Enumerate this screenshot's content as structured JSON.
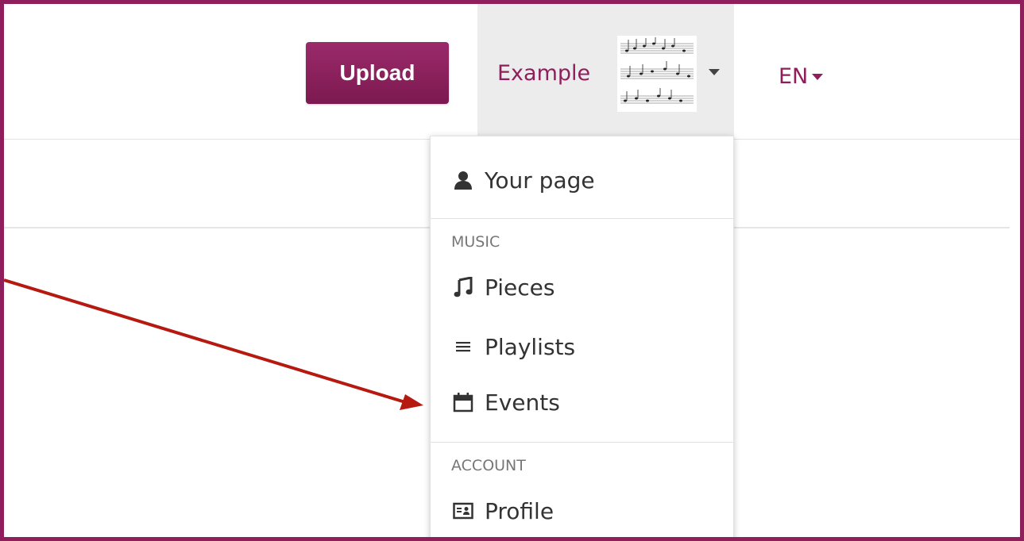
{
  "header": {
    "upload_label": "Upload",
    "user_name": "Example",
    "language": "EN"
  },
  "dropdown": {
    "your_page": "Your page",
    "music_header": "MUSIC",
    "pieces": "Pieces",
    "playlists": "Playlists",
    "events": "Events",
    "account_header": "ACCOUNT",
    "profile": "Profile"
  },
  "icons": {
    "your_page": "person-icon",
    "pieces": "music-note-icon",
    "playlists": "list-icon",
    "events": "calendar-icon",
    "profile": "id-card-icon",
    "avatar": "sheet-music-thumbnail"
  },
  "colors": {
    "brand": "#8e1f5c",
    "annotation_arrow": "#b5190f",
    "menu_bg": "#ececec"
  }
}
